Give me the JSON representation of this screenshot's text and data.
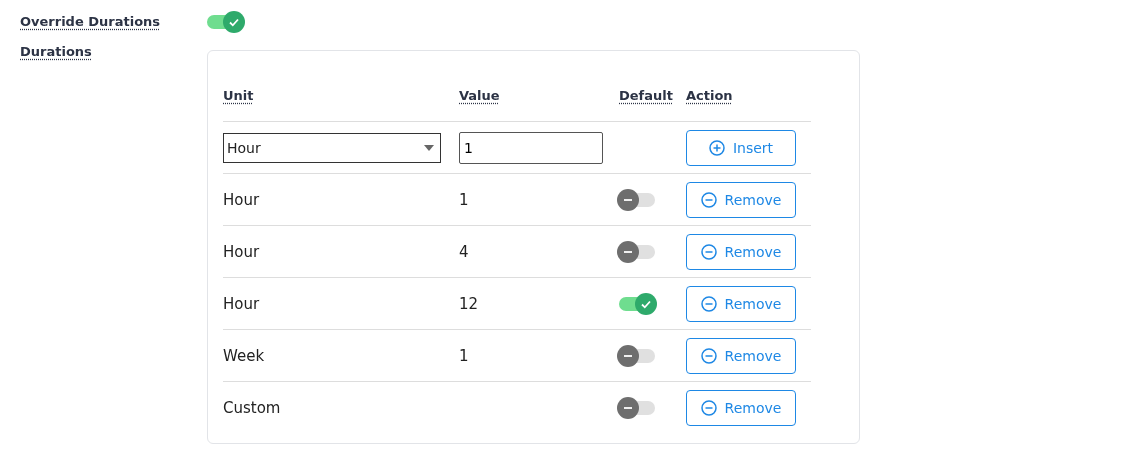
{
  "override": {
    "label": "Override Durations",
    "on": true
  },
  "durations": {
    "label": "Durations",
    "columns": [
      "Unit",
      "Value",
      "Default",
      "Action"
    ],
    "new_row": {
      "unit": "Hour",
      "value": "1",
      "button": "Insert"
    },
    "rows": [
      {
        "unit": "Hour",
        "value": "1",
        "default": false,
        "button": "Remove"
      },
      {
        "unit": "Hour",
        "value": "4",
        "default": false,
        "button": "Remove"
      },
      {
        "unit": "Hour",
        "value": "12",
        "default": true,
        "button": "Remove"
      },
      {
        "unit": "Week",
        "value": "1",
        "default": false,
        "button": "Remove"
      },
      {
        "unit": "Custom",
        "default": false,
        "button": "Remove"
      }
    ]
  }
}
